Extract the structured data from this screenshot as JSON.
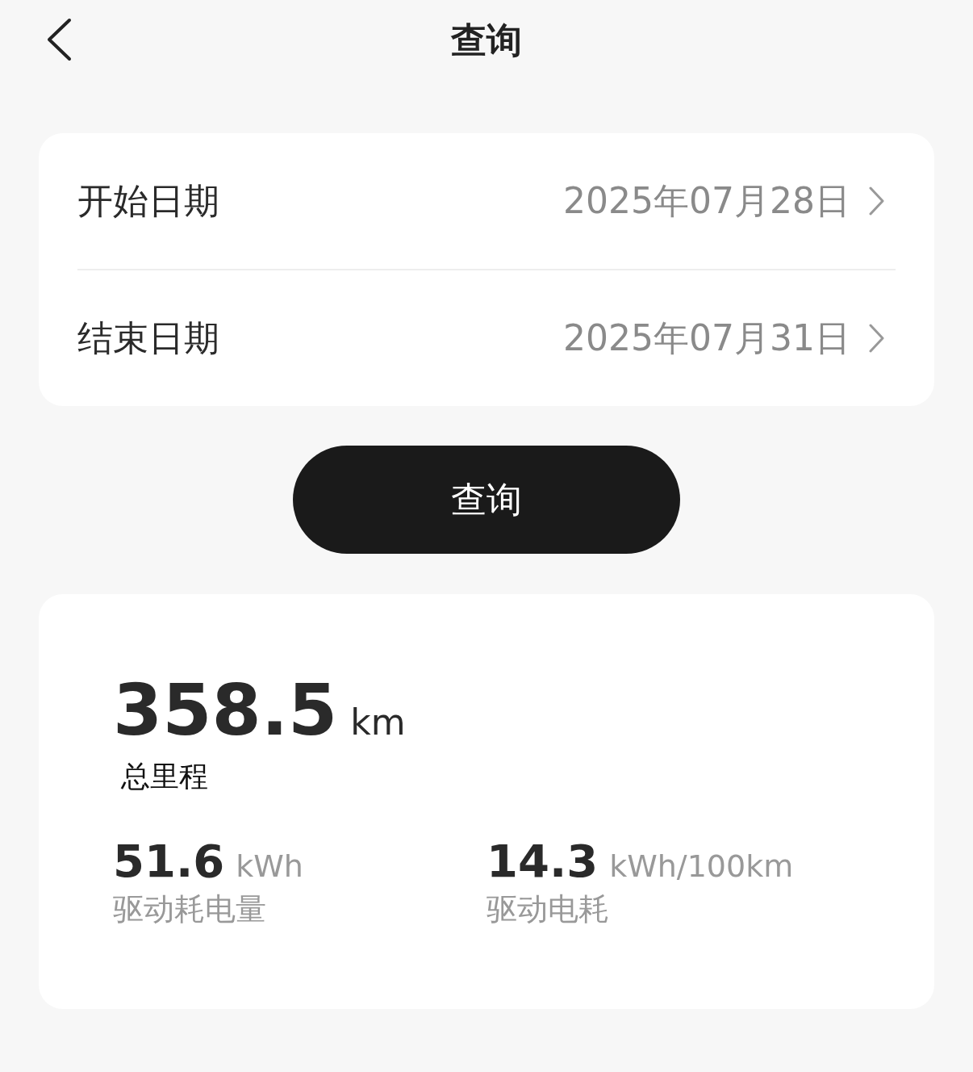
{
  "header": {
    "title": "查询"
  },
  "date_rows": [
    {
      "label": "开始日期",
      "value": "2025年07月28日"
    },
    {
      "label": "结束日期",
      "value": "2025年07月31日"
    }
  ],
  "query_button": "查询",
  "summary": {
    "total": {
      "value": "358.5",
      "unit": "km",
      "label": "总里程"
    },
    "stats": [
      {
        "value": "51.6",
        "unit": "kWh",
        "label": "驱动耗电量"
      },
      {
        "value": "14.3",
        "unit": "kWh/100km",
        "label": "驱动电耗"
      }
    ]
  }
}
